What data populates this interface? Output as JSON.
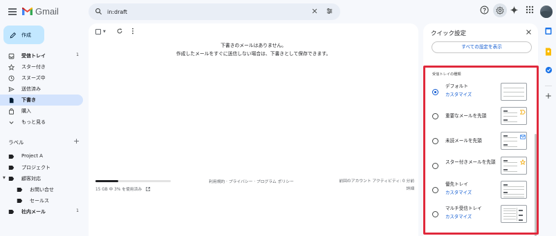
{
  "app": {
    "name": "Gmail"
  },
  "search": {
    "value": "in:draft"
  },
  "compose": {
    "label": "作成"
  },
  "nav": [
    {
      "label": "受信トレイ",
      "count": "1",
      "icon": "inbox-icon",
      "bold": true
    },
    {
      "label": "スター付き",
      "icon": "star-icon"
    },
    {
      "label": "スヌーズ中",
      "icon": "clock-icon"
    },
    {
      "label": "送信済み",
      "icon": "send-icon"
    },
    {
      "label": "下書き",
      "icon": "draft-icon",
      "bold": true,
      "active": true
    },
    {
      "label": "購入",
      "icon": "bag-icon"
    },
    {
      "label": "もっと見る",
      "icon": "chevron-down-icon"
    }
  ],
  "labels": {
    "heading": "ラベル",
    "items": [
      {
        "label": "Project A"
      },
      {
        "label": "プロジェクト"
      },
      {
        "label": "顧客対応"
      },
      {
        "label": "お問い合せ"
      },
      {
        "label": "セールス"
      },
      {
        "label": "社内メール",
        "count": "1",
        "bold": true
      }
    ]
  },
  "main": {
    "empty_title": "下書きのメールはありません。",
    "empty_body": "作成したメールをすぐに送信しない場合は、下書きとして保存できます。",
    "storage_text": "15 GB 中 3% を使用済み",
    "storage_fraction": 0.3,
    "footer_links": "利用規約 · プライバシー · プログラム ポリシー",
    "footer_activity": "前回のアカウント アクティビティ: 0 分前",
    "footer_details": "詳細"
  },
  "quick_settings": {
    "title": "クイック設定",
    "all_settings_label": "すべての設定を表示",
    "section_title": "受信トレイの種類",
    "options": [
      {
        "name": "デフォルト",
        "customize": "カスタマイズ",
        "selected": true
      },
      {
        "name": "重要なメールを先頭",
        "customize": ""
      },
      {
        "name": "未読メールを先頭",
        "customize": ""
      },
      {
        "name": "スター付きメールを先頭",
        "customize": ""
      },
      {
        "name": "優先トレイ",
        "customize": "カスタマイズ"
      },
      {
        "name": "マルチ受信トレイ",
        "customize": "カスタマイズ"
      }
    ]
  },
  "colors": {
    "accent": "#0b57d0",
    "highlight_border": "#e0283b",
    "compose_bg": "#c2e7ff",
    "active_nav_bg": "#d3e3fd"
  }
}
